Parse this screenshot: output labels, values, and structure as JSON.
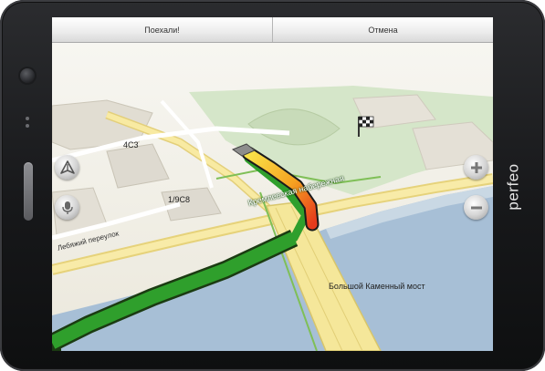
{
  "device": {
    "brand": "perfeo"
  },
  "topbar": {
    "go_label": "Поехали!",
    "cancel_label": "Отмена"
  },
  "map": {
    "building_labels": [
      "4С3",
      "1/9С8"
    ],
    "street_labels": {
      "embankment": "Кремлевская набережная",
      "lane": "Лебяжий переулок"
    },
    "bridge_label": "Большой Каменный мост",
    "route_color": "#2f9f2c",
    "traffic_colors": [
      "#e63a1c",
      "#f6a321",
      "#f8e349"
    ]
  },
  "controls": {
    "zoom_in_icon": "plus-icon",
    "zoom_out_icon": "minus-icon",
    "compass_icon": "north-arrow-icon",
    "voice_icon": "microphone-icon",
    "destination_icon": "checkered-flag-icon"
  }
}
